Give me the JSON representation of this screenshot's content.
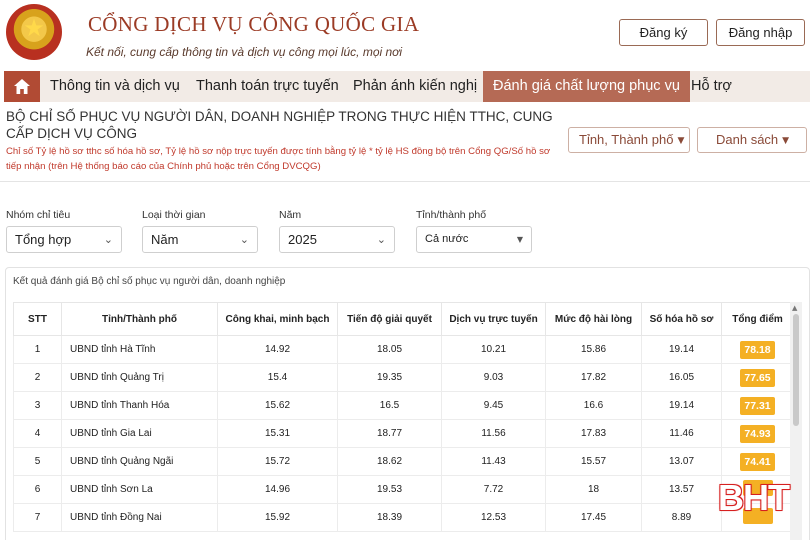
{
  "header": {
    "title": "CỔNG DỊCH VỤ CÔNG QUỐC GIA",
    "subtitle": "Kết nối, cung cấp thông tin và dịch vụ công mọi lúc, mọi nơi",
    "register_label": "Đăng ký",
    "login_label": "Đăng nhập"
  },
  "nav": {
    "items": [
      {
        "label": "Thông tin và dịch vụ"
      },
      {
        "label": "Thanh toán trực tuyến"
      },
      {
        "label": "Phản ánh kiến nghị"
      },
      {
        "label": "Đánh giá chất lượng phục vụ",
        "active": true
      },
      {
        "label": "Hỗ trợ"
      }
    ]
  },
  "section": {
    "title": "BỘ CHỈ SỐ PHỤC VỤ NGƯỜI DÂN, DOANH NGHIỆP TRONG THỰC HIỆN TTHC, CUNG CẤP DỊCH VỤ CÔNG",
    "note": "Chỉ số Tỷ lệ hồ sơ tthc số hóa hồ sơ, Tỷ lệ hồ sơ nộp trực tuyến được tính bằng tỷ lệ * tỷ lệ HS đồng bộ trên Cổng QG/Số hồ sơ tiếp nhận (trên Hệ thống báo cáo của Chính phủ hoặc trên Cổng DVCQG)",
    "province_button": "Tỉnh, Thành phố",
    "list_button": "Danh sách"
  },
  "filters": {
    "group": {
      "label": "Nhóm chỉ tiêu",
      "value": "Tổng hợp"
    },
    "period": {
      "label": "Loại thời gian",
      "value": "Năm"
    },
    "year": {
      "label": "Năm",
      "value": "2025"
    },
    "province": {
      "label": "Tỉnh/thành phố",
      "value": "Cả nước"
    }
  },
  "results": {
    "caption": "Kết quả đánh giá Bộ chỉ số phục vụ người dân, doanh nghiệp",
    "headers": [
      "STT",
      "Tỉnh/Thành phố",
      "Công khai, minh bạch",
      "Tiến độ giải quyết",
      "Dịch vụ trực tuyến",
      "Mức độ hài lòng",
      "Số hóa hồ sơ",
      "Tổng điểm"
    ],
    "rows": [
      [
        "1",
        "UBND tỉnh Hà Tĩnh",
        "14.92",
        "18.05",
        "10.21",
        "15.86",
        "19.14",
        "78.18"
      ],
      [
        "2",
        "UBND tỉnh Quảng Trị",
        "15.4",
        "19.35",
        "9.03",
        "17.82",
        "16.05",
        "77.65"
      ],
      [
        "3",
        "UBND tỉnh Thanh Hóa",
        "15.62",
        "16.5",
        "9.45",
        "16.6",
        "19.14",
        "77.31"
      ],
      [
        "4",
        "UBND tỉnh Gia Lai",
        "15.31",
        "18.77",
        "11.56",
        "17.83",
        "11.46",
        "74.93"
      ],
      [
        "5",
        "UBND tỉnh Quảng Ngãi",
        "15.72",
        "18.62",
        "11.43",
        "15.57",
        "13.07",
        "74.41"
      ],
      [
        "6",
        "UBND tỉnh Sơn La",
        "14.96",
        "19.53",
        "7.72",
        "18",
        "13.57",
        ""
      ],
      [
        "7",
        "UBND tỉnh Đồng Nai",
        "15.92",
        "18.39",
        "12.53",
        "17.45",
        "8.89",
        ""
      ]
    ]
  },
  "watermark": "BHT",
  "colors": {
    "brand": "#9b3b25",
    "nav_active": "#b56a55",
    "score_badge": "#f4b024",
    "note_text": "#c0392b"
  }
}
